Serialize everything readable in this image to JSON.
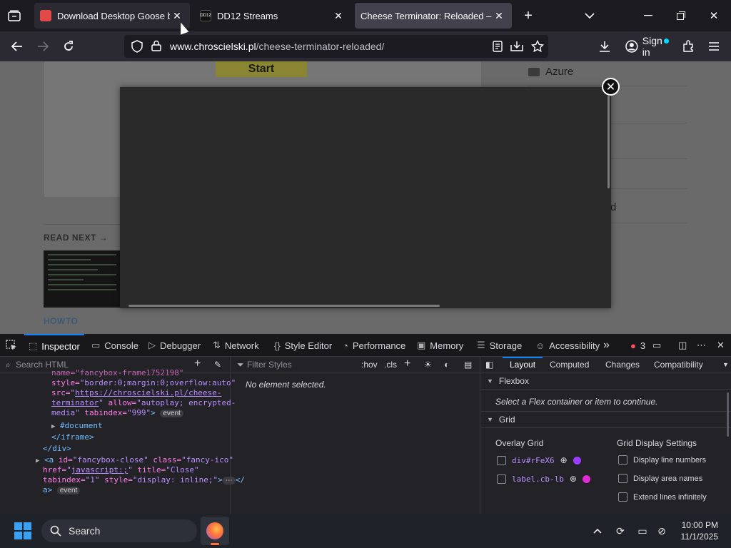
{
  "browser": {
    "tabs": [
      {
        "title": "Download Desktop Goose by ...",
        "favicon": "itch-icon"
      },
      {
        "title": "DD12 Streams",
        "favicon": "dd12-icon",
        "favicon_text": "DD12"
      },
      {
        "title": "Cheese Terminator: Reloaded – Chro...",
        "favicon": "none"
      }
    ],
    "url_host": "www.chroscielski.pl",
    "url_path": "/cheese-terminator-reloaded/",
    "sign_in_label": "Sign in"
  },
  "page": {
    "start_label": "Start",
    "read_next": "READ NEXT →",
    "howto": "HOWTO",
    "sidebar_azure": "Azure",
    "sidebar_partial": "d"
  },
  "devtools": {
    "tabs": [
      "Inspector",
      "Console",
      "Debugger",
      "Network",
      "Style Editor",
      "Performance",
      "Memory",
      "Storage",
      "Accessibility"
    ],
    "error_count": "3",
    "search_html_placeholder": "Search HTML",
    "filter_styles_placeholder": "Filter Styles",
    "hov": ":hov",
    "cls": ".cls",
    "no_element": "No element selected.",
    "layout_tabs": [
      "Layout",
      "Computed",
      "Changes",
      "Compatibility"
    ],
    "flexbox": "Flexbox",
    "flexbox_msg": "Select a Flex container or item to continue.",
    "grid": "Grid",
    "overlay_grid": "Overlay Grid",
    "grid_display_settings": "Grid Display Settings",
    "overlay_items": [
      {
        "label": "div#rFeX6",
        "color": "#9b3cff"
      },
      {
        "label": "label.cb-lb",
        "color": "#e22bd6"
      }
    ],
    "display_settings": [
      "Display line numbers",
      "Display area names",
      "Extend lines infinitely"
    ],
    "markup": {
      "l0": "name=\"fancybox-frame1752198\"",
      "style_attr": "style=",
      "style_val": "\"border:0;margin:0;overflow:auto\"",
      "src_attr": "src=",
      "src_val_1": "https://chroscielski.pl/cheese-",
      "src_val_2": "terminator",
      "allow_attr": "allow=",
      "allow_val_1": "\"autoplay; encrypted-",
      "allow_val_2": "media\"",
      "tabindex_attr": "tabindex=",
      "tabindex_val": "\"999\"",
      "event": "event",
      "document": "#document",
      "close_iframe": "</iframe>",
      "close_div": "</div>",
      "a_open": "<a",
      "id_attr": "id=",
      "id_val": "\"fancybox-close\"",
      "class_attr": "class=",
      "class_val": "\"fancy-ico\"",
      "href_attr": "href=",
      "href_val": "javascript:;",
      "title_attr": "title=",
      "title_val": "\"Close\"",
      "tab1_attr": "tabindex=",
      "tab1_val": "\"1\"",
      "style2_attr": "style=",
      "style2_val": "\"display: inline;\"",
      "a_close": "a>"
    }
  },
  "taskbar": {
    "search_label": "Search",
    "time": "10:00 PM",
    "date": "11/1/2025"
  }
}
